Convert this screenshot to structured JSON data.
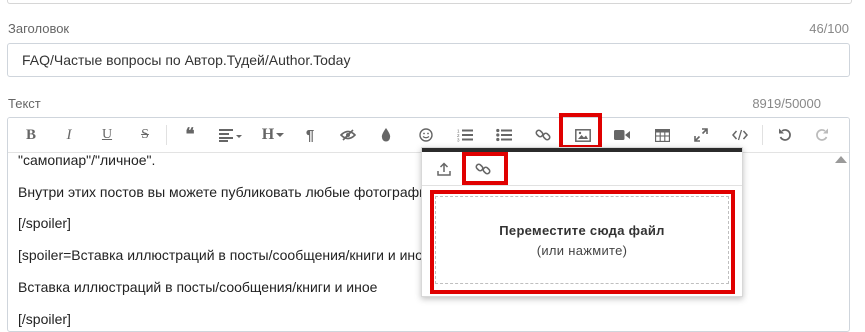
{
  "title_field": {
    "label": "Заголовок",
    "counter": "46/100",
    "value": "FAQ/Частые вопросы по Автор.Тудей/Author.Today"
  },
  "text_field": {
    "label": "Текст",
    "counter": "8919/50000"
  },
  "toolbar": {
    "bold": "B",
    "italic": "I",
    "underline": "U",
    "strike": "S",
    "quote": "❝",
    "heading": "H"
  },
  "editor_lines": [
    "\"самопиар\"/\"личное\".",
    "Внутри этих постов вы можете публиковать любые фотографи",
    "[/spoiler]",
    "[spoiler=Вставка иллюстраций в посты/сообщения/книги и ино",
    "Вставка иллюстраций в посты/сообщения/книги и иное",
    "[/spoiler]"
  ],
  "image_popup": {
    "drop_text": "Переместите сюда файл",
    "click_text": "(или нажмите)"
  },
  "colors": {
    "highlight": "#e00000",
    "popup_bar": "#2b2b2b"
  }
}
